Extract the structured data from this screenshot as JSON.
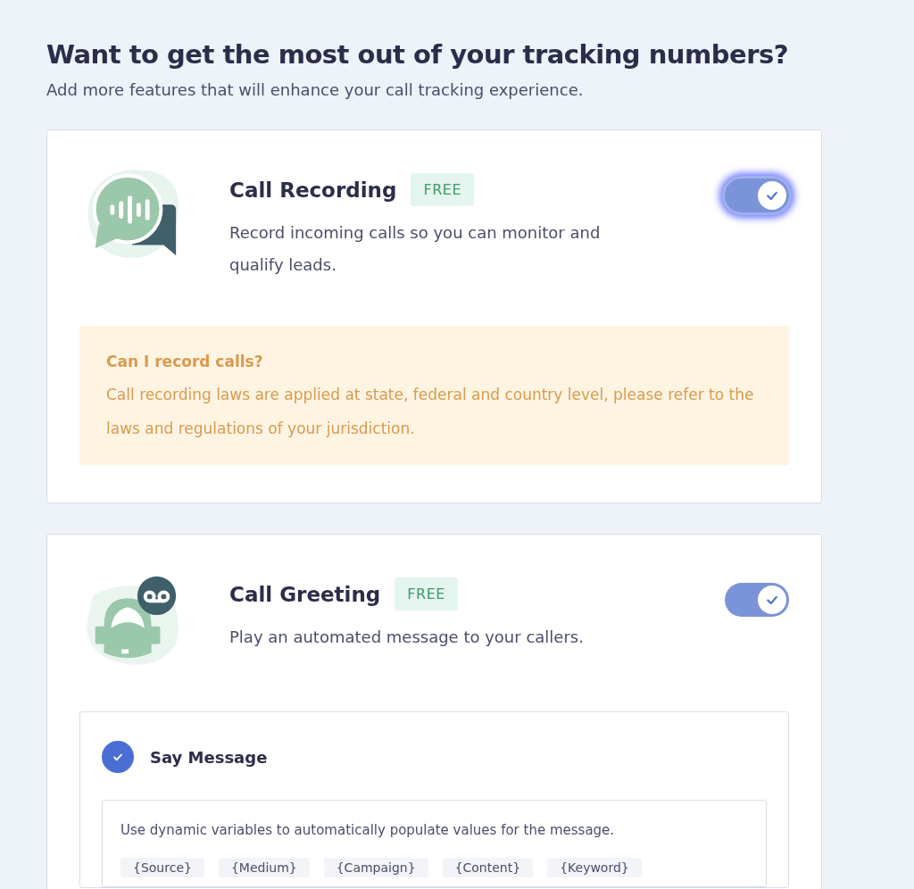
{
  "heading": "Want to get the most out of your tracking numbers?",
  "subheading": "Add more features that will enhance your call tracking experience.",
  "features": [
    {
      "kind": "recording",
      "title": "Call Recording",
      "badge": "FREE",
      "description": "Record incoming calls so you can monitor and qualify leads.",
      "toggle": {
        "on": true,
        "focused": true
      },
      "notice": {
        "title": "Can I record calls?",
        "text": "Call recording laws are applied at state, federal and country level, please refer to the laws and regulations of your jurisdiction."
      }
    },
    {
      "kind": "greeting",
      "title": "Call Greeting",
      "badge": "FREE",
      "description": "Play an automated message to your callers.",
      "toggle": {
        "on": true,
        "focused": false
      },
      "option": {
        "label": "Say Message",
        "selected": true,
        "hint": "Use dynamic variables to automatically populate values for the message.",
        "variables": [
          "{Source}",
          "{Medium}",
          "{Campaign}",
          "{Content}",
          "{Keyword}"
        ]
      }
    }
  ]
}
